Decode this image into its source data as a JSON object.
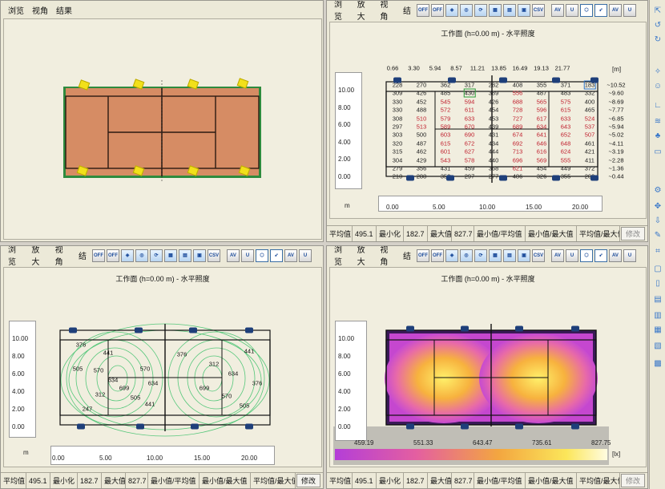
{
  "menus": {
    "view": "浏览",
    "zoom": "放大",
    "angle": "视角",
    "results": "结果"
  },
  "toolbar": {
    "off1": "OFF",
    "off2": "OFF",
    "csv": "CSV",
    "av": "AV",
    "u": "U"
  },
  "work_title": "工作面 (h=0.00 m) - 水平照度",
  "units": {
    "m": "m",
    "m_bracket": "[m]",
    "lx": "[lx]"
  },
  "top_x_ticks": [
    "0.66",
    "3.30",
    "5.94",
    "8.57",
    "11.21",
    "13.85",
    "16.49",
    "19.13",
    "21.77"
  ],
  "right_y_ticks": [
    "10.52",
    "9.60",
    "8.69",
    "7.77",
    "6.85",
    "5.94",
    "5.02",
    "4.11",
    "3.19",
    "2.28",
    "1.36",
    "0.44"
  ],
  "y_ticks": [
    "10.00",
    "8.00",
    "6.00",
    "4.00",
    "2.00",
    "0.00"
  ],
  "x_ticks": [
    "0.00",
    "5.00",
    "10.00",
    "15.00",
    "20.00"
  ],
  "grid_values": [
    [
      "228",
      "270",
      "362",
      "317",
      "282",
      "408",
      "355",
      "371",
      "183"
    ],
    [
      "309",
      "426",
      "485",
      "430",
      "389",
      "556",
      "487",
      "483",
      "332"
    ],
    [
      "330",
      "452",
      "545",
      "594",
      "426",
      "688",
      "565",
      "575",
      "400"
    ],
    [
      "330",
      "488",
      "572",
      "611",
      "454",
      "728",
      "596",
      "615",
      "465"
    ],
    [
      "308",
      "510",
      "579",
      "633",
      "453",
      "727",
      "617",
      "633",
      "524"
    ],
    [
      "297",
      "513",
      "589",
      "670",
      "439",
      "689",
      "634",
      "643",
      "537"
    ],
    [
      "303",
      "500",
      "603",
      "690",
      "431",
      "674",
      "641",
      "652",
      "507"
    ],
    [
      "320",
      "487",
      "615",
      "672",
      "434",
      "692",
      "646",
      "648",
      "461"
    ],
    [
      "315",
      "462",
      "601",
      "627",
      "444",
      "713",
      "616",
      "624",
      "421"
    ],
    [
      "304",
      "429",
      "543",
      "578",
      "440",
      "696",
      "569",
      "555",
      "411"
    ],
    [
      "279",
      "356",
      "431",
      "459",
      "368",
      "621",
      "454",
      "449",
      "372"
    ],
    [
      "210",
      "288",
      "352",
      "297",
      "277",
      "486",
      "326",
      "355",
      "209"
    ]
  ],
  "contour_labels": [
    "376",
    "441",
    "505",
    "570",
    "634",
    "699",
    "312",
    "247",
    "570",
    "634",
    "505",
    "441",
    "376",
    "312",
    "634",
    "699",
    "570",
    "505",
    "441",
    "376"
  ],
  "legend_ticks": [
    "459.19",
    "551.33",
    "643.47",
    "735.61",
    "827.75"
  ],
  "status": {
    "avg_label": "平均值",
    "avg_value": "495.1",
    "min_label": "最小化",
    "min_value": "182.7",
    "max_label": "最大值",
    "max_value": "827.7",
    "min_avg": "最小值/平均值",
    "min_max": "最小值/最大值",
    "avg_max": "平均值/最大值",
    "modify": "修改"
  }
}
